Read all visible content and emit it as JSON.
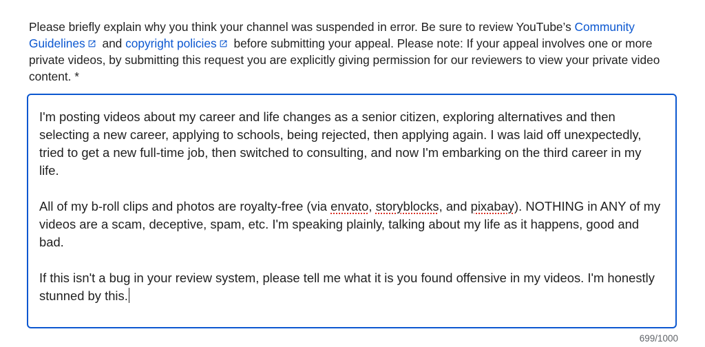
{
  "instructions": {
    "part1": "Please briefly explain why you think your channel was suspended in error. Be sure to review YouTube’s ",
    "link1": "Community Guidelines",
    "between": " and ",
    "link2": "copyright policies",
    "part2": " before submitting your appeal. Please note: If your appeal involves one or more private videos, by submitting this request you are explicitly giving permission for our reviewers to view your private video content. *",
    "link_icon": "external-link-icon"
  },
  "appeal": {
    "p1": "I'm posting videos about my career and life changes as a senior citizen, exploring alternatives and then selecting a new career, applying to schools, being rejected, then applying again.  I was laid off unexpectedly, tried to get a new full-time job, then switched to consulting, and now I'm embarking on the third career in my life.",
    "p2_a": "All of my b-roll clips and photos are royalty-free (via ",
    "p2_w1": "envato",
    "p2_b": ", ",
    "p2_w2": "storyblocks",
    "p2_c": ", and ",
    "p2_w3": "pixabay",
    "p2_d": ").  NOTHING in ANY of my videos are a scam, deceptive, spam, etc.  I'm speaking plainly, talking about my life as it happens, good and bad.",
    "p3": "If this isn't a bug in your review system, please tell me what it is you found offensive in my videos. I'm honestly stunned by this."
  },
  "counter": "699/1000",
  "colors": {
    "link": "#0b57d0",
    "focus_border": "#0b57d0",
    "spellcheck": "#d93025"
  }
}
